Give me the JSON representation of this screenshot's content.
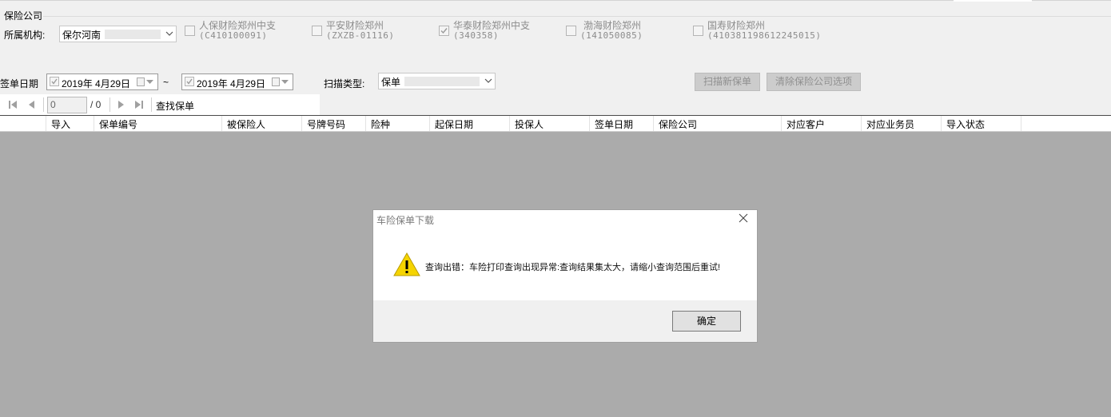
{
  "filter": {
    "group_title": "保险公司",
    "org_label": "所属机构:",
    "org_value": "保尔河南",
    "companies": [
      {
        "name": "人保财险郑州中支",
        "code": "(C410100091)",
        "checked": false
      },
      {
        "name": "平安财险郑州",
        "code": "(ZXZB-01116)",
        "checked": false
      },
      {
        "name": "华泰财险郑州中支",
        "code": "(340358)",
        "checked": true
      },
      {
        "name": "渤海财险郑州",
        "code": "(141050085)",
        "checked": false
      },
      {
        "name": "国寿财险郑州",
        "code": "(410381198612245015)",
        "checked": false
      }
    ],
    "date_label": "签单日期",
    "date_from": "2019年 4月29日",
    "date_sep": "~",
    "date_to": "2019年 4月29日",
    "scan_type_label": "扫描类型:",
    "scan_type_value": "保单",
    "scan_button": "扫描新保单",
    "clear_button": "清除保险公司选项"
  },
  "toolbar": {
    "page_value": "0",
    "page_total": "/ 0",
    "find_button": "查找保单"
  },
  "grid": {
    "columns": [
      "导入",
      "保单编号",
      "被保险人",
      "号牌号码",
      "险种",
      "起保日期",
      "投保人",
      "签单日期",
      "保险公司",
      "对应客户",
      "对应业务员",
      "导入状态"
    ]
  },
  "dialog": {
    "title": "车险保单下载",
    "message": "查询出错：车险打印查询出现异常:查询结果集太大，请缩小查询范围后重试!",
    "ok_label": "确定",
    "icon": "warning-icon",
    "warning_color": "#f5d400"
  }
}
